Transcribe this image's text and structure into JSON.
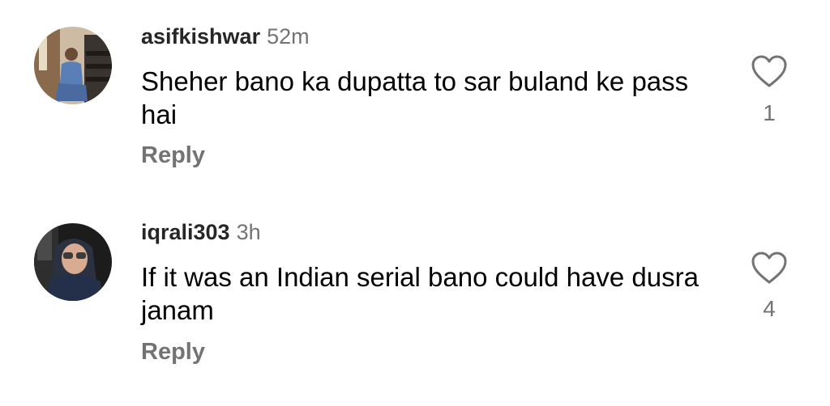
{
  "comments": [
    {
      "username": "asifkishwar",
      "time": "52m",
      "text": "Sheher bano ka dupatta to sar buland ke pass hai",
      "reply_label": "Reply",
      "likes": "1",
      "like_icon": "heart-outline-icon"
    },
    {
      "username": "iqrali303",
      "time": "3h",
      "text": "If it was an Indian serial bano could have dusra janam",
      "reply_label": "Reply",
      "likes": "4",
      "like_icon": "heart-outline-icon"
    }
  ]
}
